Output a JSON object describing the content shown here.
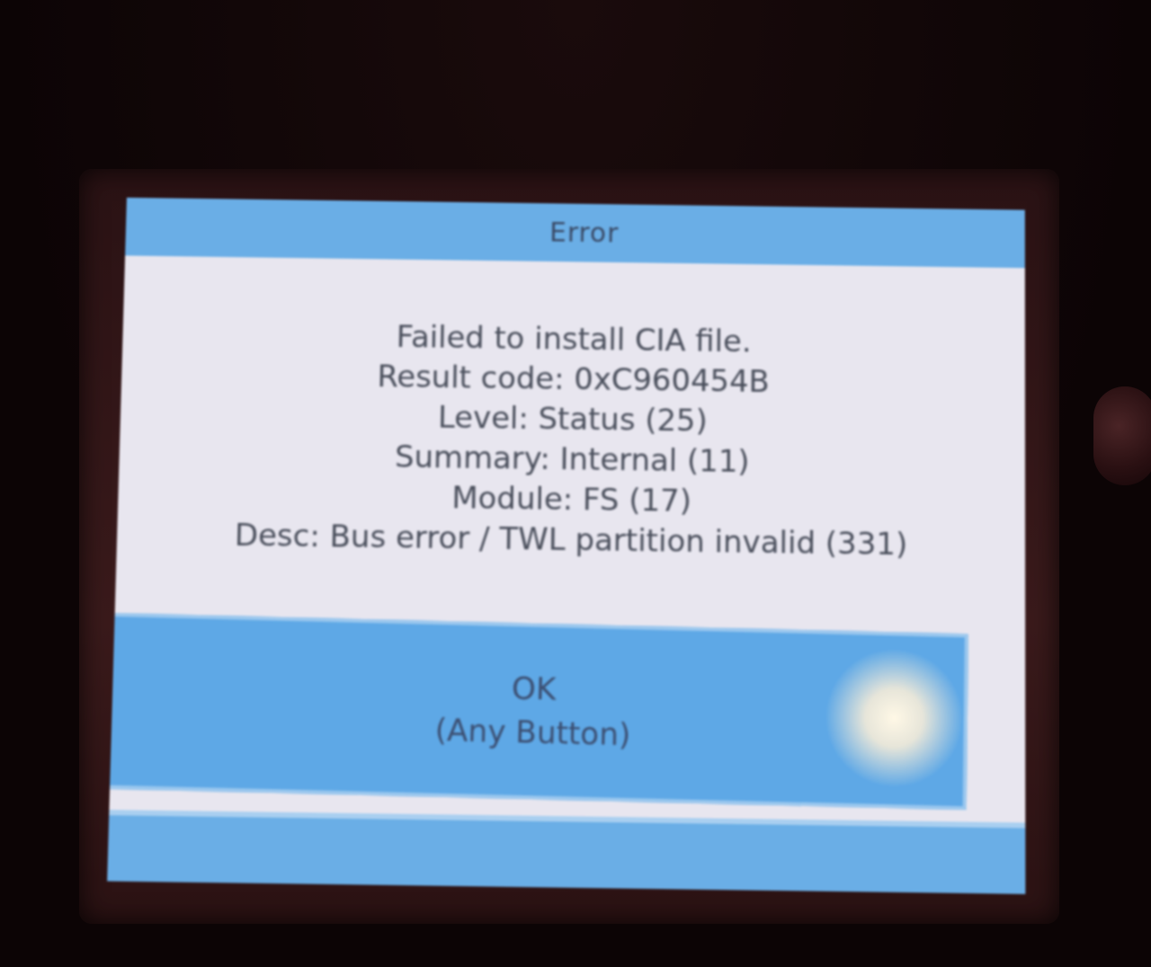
{
  "dialog": {
    "title": "Error",
    "lines": [
      "Failed to install CIA file.",
      "Result code: 0xC960454B",
      "Level: Status (25)",
      "Summary: Internal (11)",
      "Module: FS (17)",
      "Desc: Bus error / TWL partition invalid (331)"
    ],
    "ok_label": "OK",
    "ok_hint": "(Any Button)"
  },
  "colors": {
    "title_bar": "#6aaee6",
    "button": "#5ea8e6",
    "background": "#e8e6ef",
    "text": "#4a4f5c"
  }
}
